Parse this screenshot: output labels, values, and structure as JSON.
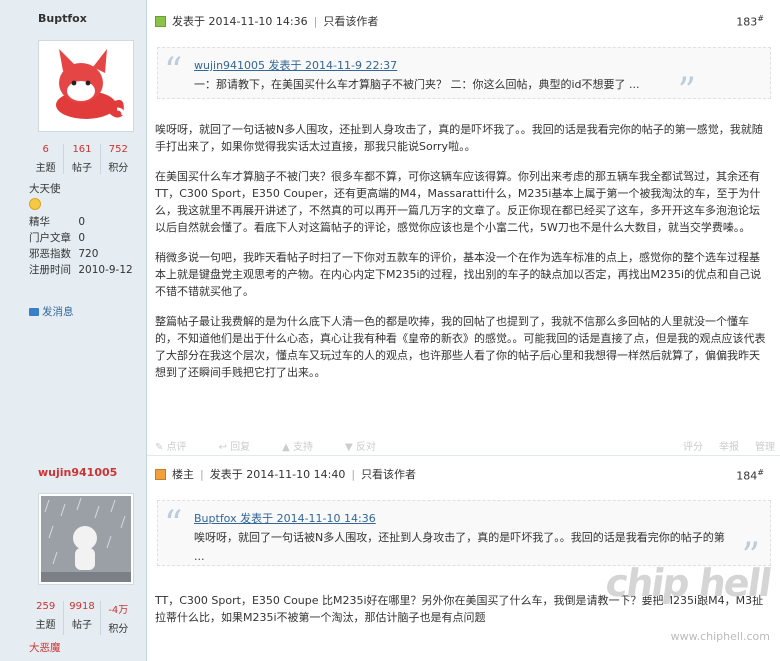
{
  "post1": {
    "username": "Buptfox",
    "stats": [
      {
        "value": "6",
        "label": "主题"
      },
      {
        "value": "161",
        "label": "帖子"
      },
      {
        "value": "752",
        "label": "积分"
      }
    ],
    "rank": "大天使",
    "info": [
      {
        "k": "精华",
        "v": "0"
      },
      {
        "k": "门户文章",
        "v": "0"
      },
      {
        "k": "邪恶指数",
        "v": "720"
      },
      {
        "k": "注册时间",
        "v": "2010-9-12"
      }
    ],
    "message": "发消息",
    "posted": "发表于 2014-11-10 14:36",
    "only_author": "只看该作者",
    "floor": "183",
    "quote_author": "wujin941005 发表于 2014-11-9 22:37",
    "quote_text": "一：那请教下，在美国买什么车才算脑子不被门夹？ 二：你这么回帖，典型的id不想要了 ...",
    "paragraphs": [
      "唉呀呀，就回了一句话被N多人围攻，还扯到人身攻击了，真的是吓坏我了。。我回的话是我看完你的帖子的第一感觉，我就随手打出来了，如果你觉得我实话太过直接，那我只能说Sorry啦。。",
      "在美国买什么车才算脑子不被门夹？很多车都不算，可你这辆车应该得算。你列出来考虑的那五辆车我全都试驾过，其余还有 TT，C300 Sport，E350 Couper，还有更高端的M4，Massaratti什么，M235i基本上属于第一个被我淘汰的车，至于为什么，我这就里不再展开讲述了，不然真的可以再开一篇几万字的文章了。反正你现在都已经买了这车，多开开这车多泡泡论坛以后自然就会懂了。看底下人对这篇帖子的评论，感觉你应该也是个小富二代，5W刀也不是什么大数目，就当交学费嗪。。",
      "稍微多说一句吧，我昨天看帖子时扫了一下你对五款车的评价，基本没一个在作为选车标准的点上，感觉你的整个选车过程基本上就是键盘党主观思考的产物。在内心内定下M235i的过程，找出别的车子的缺点加以否定，再找出M235i的优点和自己说不错不错就买他了。",
      "整篇帖子最让我费解的是为什么底下人清一色的都是吹捧，我的回帖了也提到了，我就不信那么多回帖的人里就没一个懂车的，不知道他们是出于什么心态，真心让我有种看《皇帝的新衣》的感觉。。可能我回的话是直接了点，但是我的观点应该代表了大部分在我这个层次，懂点车又玩过车的人的观点，也许那些人看了你的帖子后心里和我想得一样然后就算了，偏偏我昨天想到了还瞬间手贱把它打了出来。。"
    ],
    "actions": [
      "点评",
      "回复",
      "支持",
      "反对"
    ],
    "actions_right": [
      "评分",
      "举报",
      "管理"
    ]
  },
  "post2": {
    "username": "wujin941005",
    "stats": [
      {
        "value": "259",
        "label": "主题"
      },
      {
        "value": "9918",
        "label": "帖子"
      },
      {
        "value": "-4万",
        "label": "积分"
      }
    ],
    "rank": "大恶魔",
    "badge": "楼主",
    "posted": "发表于 2014-11-10 14:40",
    "only_author": "只看该作者",
    "floor": "184",
    "quote_author": "Buptfox 发表于 2014-11-10 14:36",
    "quote_text": "唉呀呀，就回了一句话被N多人围攻，还扯到人身攻击了，真的是吓坏我了。。我回的话是我看完你的帖子的第 ...",
    "paragraphs": [
      "TT，C300 Sport，E350 Coupe 比M235i好在哪里？另外你在美国买了什么车，我倒是请教一下？要把M235i跟M4，M3扯拉蒂什么比，如果M235i不被第一个淘汰，那估计脑子也是有点问题"
    ]
  },
  "watermark": "www.chiphell.com",
  "watermark_logo": "chip hell"
}
